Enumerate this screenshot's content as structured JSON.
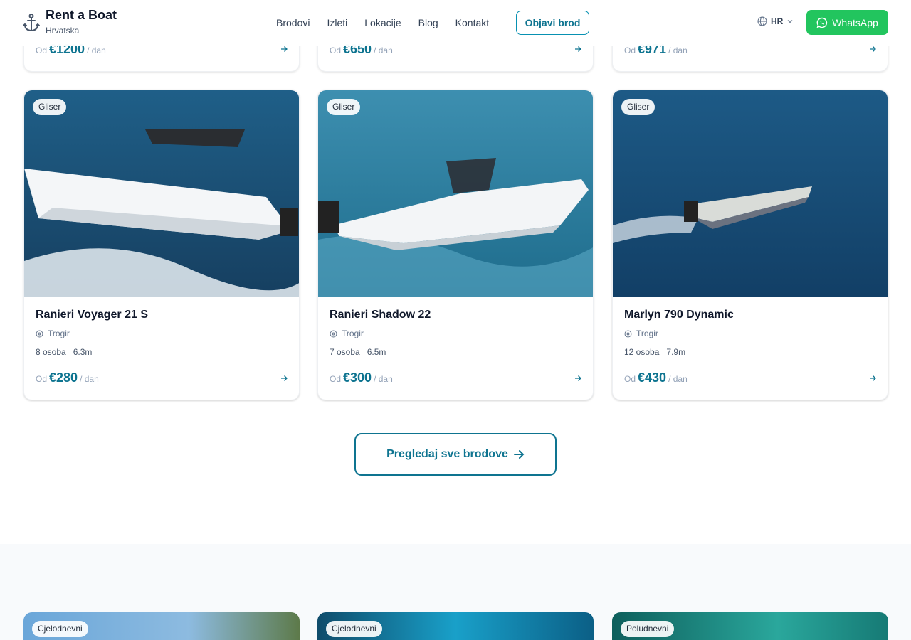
{
  "header": {
    "brand_title": "Rent a Boat",
    "brand_subtitle": "Hrvatska",
    "nav": [
      "Brodovi",
      "Izleti",
      "Lokacije",
      "Blog",
      "Kontakt"
    ],
    "publish_label": "Objavi brod",
    "language": "HR",
    "whatsapp_label": "WhatsApp",
    "colors": {
      "accent": "#0e7490",
      "whatsapp": "#22c55e"
    }
  },
  "top_cards": [
    {
      "price_prefix": "Od",
      "price": "€1200",
      "price_suffix": "/ dan"
    },
    {
      "price_prefix": "Od",
      "price": "€650",
      "price_suffix": "/ dan"
    },
    {
      "price_prefix": "Od",
      "price": "€971",
      "price_suffix": "/ dan"
    }
  ],
  "boats": [
    {
      "badge": "Gliser",
      "name": "Ranieri Voyager 21 S",
      "location": "Trogir",
      "capacity": "8 osoba",
      "length": "6.3m",
      "price_prefix": "Od",
      "price": "€280",
      "price_suffix": "/ dan"
    },
    {
      "badge": "Gliser",
      "name": "Ranieri Shadow 22",
      "location": "Trogir",
      "capacity": "7 osoba",
      "length": "6.5m",
      "price_prefix": "Od",
      "price": "€300",
      "price_suffix": "/ dan"
    },
    {
      "badge": "Gliser",
      "name": "Marlyn 790 Dynamic",
      "location": "Trogir",
      "capacity": "12 osoba",
      "length": "7.9m",
      "price_prefix": "Od",
      "price": "€430",
      "price_suffix": "/ dan"
    }
  ],
  "view_all_label": "Pregledaj sve brodove",
  "tours": [
    {
      "badge": "Cjelodnevni"
    },
    {
      "badge": "Cjelodnevni"
    },
    {
      "badge": "Poludnevni"
    }
  ]
}
